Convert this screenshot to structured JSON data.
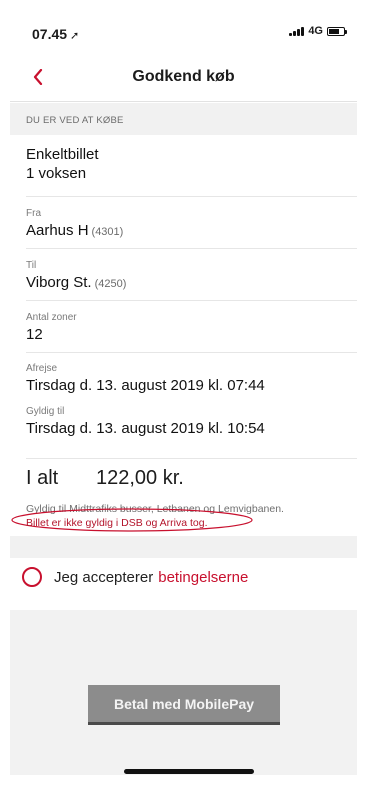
{
  "statusbar": {
    "time": "07.45",
    "location_icon": "location-arrow-icon",
    "network": "4G",
    "battery_level": 0.7
  },
  "navbar": {
    "title": "Godkend køb",
    "back_icon": "chevron-left-icon"
  },
  "section": {
    "header": "DU ER VED AT KØBE"
  },
  "ticket": {
    "type": "Enkeltbillet",
    "passengers": "1 voksen",
    "from_label": "Fra",
    "from_value": "Aarhus H",
    "from_code": "(4301)",
    "to_label": "Til",
    "to_value": "Viborg St.",
    "to_code": "(4250)",
    "zones_label": "Antal zoner",
    "zones_value": "12",
    "departure_label": "Afrejse",
    "departure_value": "Tirsdag d. 13. august 2019 kl. 07:44",
    "valid_label": "Gyldig til",
    "valid_value": "Tirsdag d. 13. august 2019 kl. 10:54"
  },
  "total": {
    "label": "I alt",
    "amount": "122,00 kr."
  },
  "notes": {
    "validity": "Gyldig til Midttrafiks busser, Letbanen og Lemvigbanen.",
    "warning": "Billet er ikke gyldig i DSB og Arriva tog."
  },
  "accept": {
    "text": "Jeg accepterer",
    "link": "betingelserne"
  },
  "pay_button": {
    "label": "Betal med MobilePay"
  },
  "colors": {
    "accent": "#c8102e",
    "button": "#8c8c8c",
    "section_bg": "#f1f1f1"
  }
}
